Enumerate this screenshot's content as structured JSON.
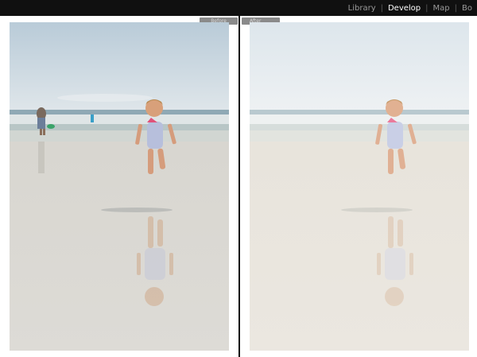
{
  "nav": {
    "library": "Library",
    "develop": "Develop",
    "map": "Map",
    "book": "Bo",
    "separator": "|"
  },
  "compare": {
    "before_label": "Before",
    "after_label": "After"
  },
  "photo": {
    "subject": "beach-child-photo",
    "before_filter": "normal",
    "after_filter": "faded"
  },
  "colors": {
    "active_module": "#ffffff",
    "inactive_module": "#9a9a9a"
  }
}
